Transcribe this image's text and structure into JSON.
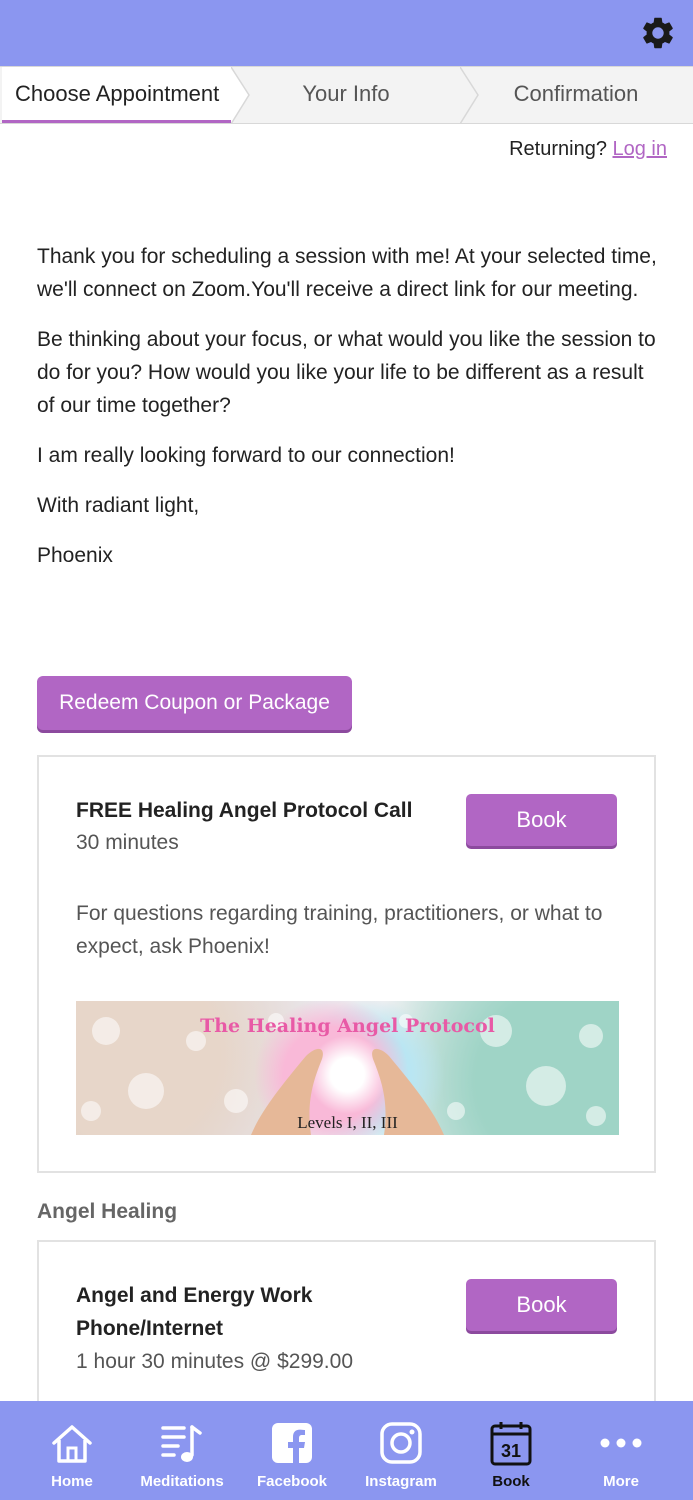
{
  "steps": [
    {
      "label": "Choose Appointment"
    },
    {
      "label": "Your Info"
    },
    {
      "label": "Confirmation"
    }
  ],
  "login": {
    "prompt": "Returning?",
    "link": "Log in"
  },
  "intro": [
    "Thank you for scheduling a session with me! At your selected time, we'll connect on Zoom.You'll receive a direct link for our meeting.",
    "Be thinking about your focus, or what would you like the session to do for you? How would you like your life to be different as a result of our time together?",
    "I am really looking forward to our connection!",
    "With radiant light,",
    "Phoenix"
  ],
  "coupon_button": "Redeem Coupon or Package",
  "appointments": [
    {
      "title": "FREE Healing Angel Protocol Call",
      "duration": "30 minutes",
      "description": "For questions regarding training, practitioners, or what to expect, ask Phoenix!",
      "book_label": "Book",
      "banner": {
        "title": "The Healing Angel Protocol",
        "subtitle": "Levels I, II, III"
      }
    },
    {
      "title": "Angel and Energy Work Phone/Internet",
      "duration": "1 hour 30 minutes @ $299.00",
      "book_label": "Book"
    }
  ],
  "section_heading": "Angel Healing",
  "tabs": [
    {
      "label": "Home",
      "icon": "home-icon"
    },
    {
      "label": "Meditations",
      "icon": "music-list-icon"
    },
    {
      "label": "Facebook",
      "icon": "facebook-icon"
    },
    {
      "label": "Instagram",
      "icon": "instagram-icon"
    },
    {
      "label": "Book",
      "icon": "calendar-icon",
      "active": true,
      "calendar_day": "31"
    },
    {
      "label": "More",
      "icon": "more-icon"
    }
  ],
  "colors": {
    "header": "#8b96f0",
    "accent": "#b166c4",
    "tab_active": "#111111"
  }
}
